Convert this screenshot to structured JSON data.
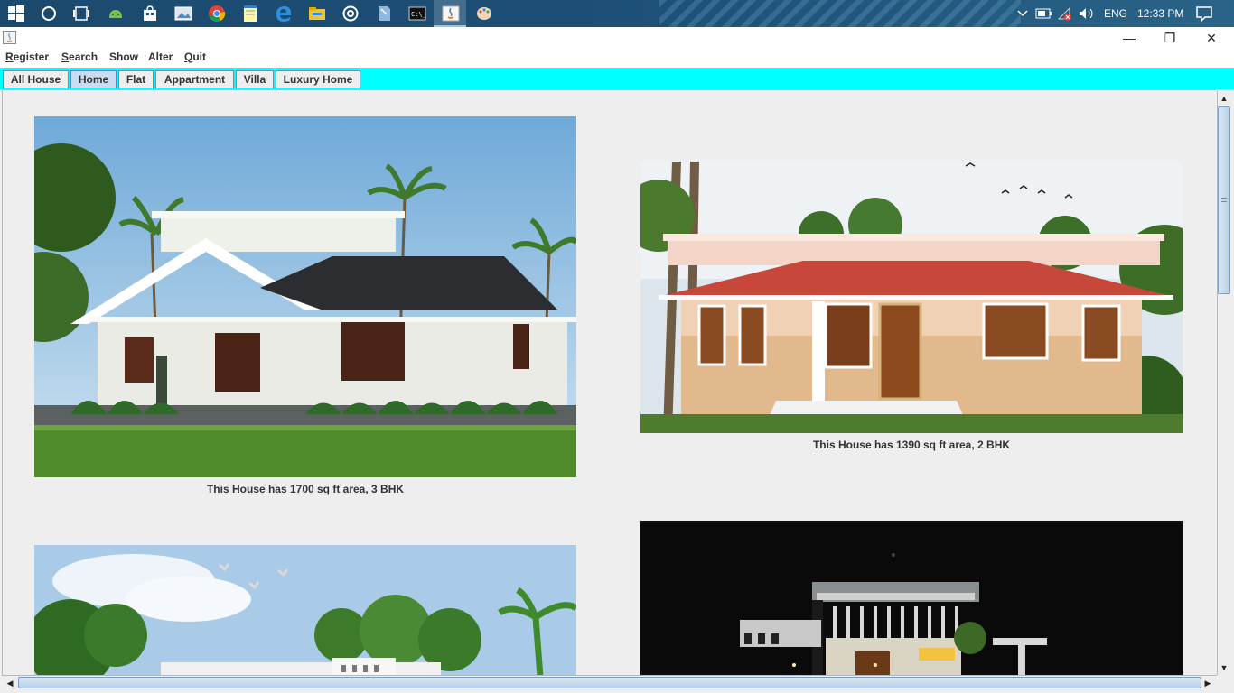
{
  "taskbar": {
    "icons": [
      "windows-start-icon",
      "cortana-icon",
      "task-view-icon",
      "android-studio-icon",
      "store-icon",
      "photos-icon",
      "chrome-icon",
      "notepad-icon",
      "edge-icon",
      "file-explorer-icon",
      "settings-icon",
      "notes-icon",
      "cmd-icon",
      "java-app-icon",
      "paint-icon"
    ],
    "language": "ENG",
    "time": "12:33 PM"
  },
  "window": {
    "title": "",
    "minimize_glyph": "—",
    "restore_glyph": "❐",
    "close_glyph": "✕"
  },
  "menu": {
    "items": [
      {
        "label": "Register",
        "mnemonic": "R",
        "rest": "egister"
      },
      {
        "label": "Search",
        "mnemonic": "S",
        "rest": "earch"
      },
      {
        "label": "Show",
        "mnemonic": "",
        "rest": "Show"
      },
      {
        "label": "Alter",
        "mnemonic": "",
        "rest": "Alter"
      },
      {
        "label": "Quit",
        "mnemonic": "Q",
        "rest": "uit"
      }
    ]
  },
  "tabs": [
    {
      "label": "All House",
      "selected": false
    },
    {
      "label": "Home",
      "selected": true
    },
    {
      "label": "Flat",
      "selected": false
    },
    {
      "label": "Appartment",
      "selected": false
    },
    {
      "label": "Villa",
      "selected": false
    },
    {
      "label": "Luxury Home",
      "selected": false
    }
  ],
  "houses": [
    {
      "caption": "This House has 1700 sq ft area, 3 BHK"
    },
    {
      "caption": "This House has 1390 sq ft area, 2 BHK"
    },
    {
      "caption": ""
    },
    {
      "caption": ""
    }
  ],
  "colors": {
    "tab_strip": "#00ffff",
    "selected_tab": "#c8ddf2",
    "taskbar": "#1d4f77"
  }
}
